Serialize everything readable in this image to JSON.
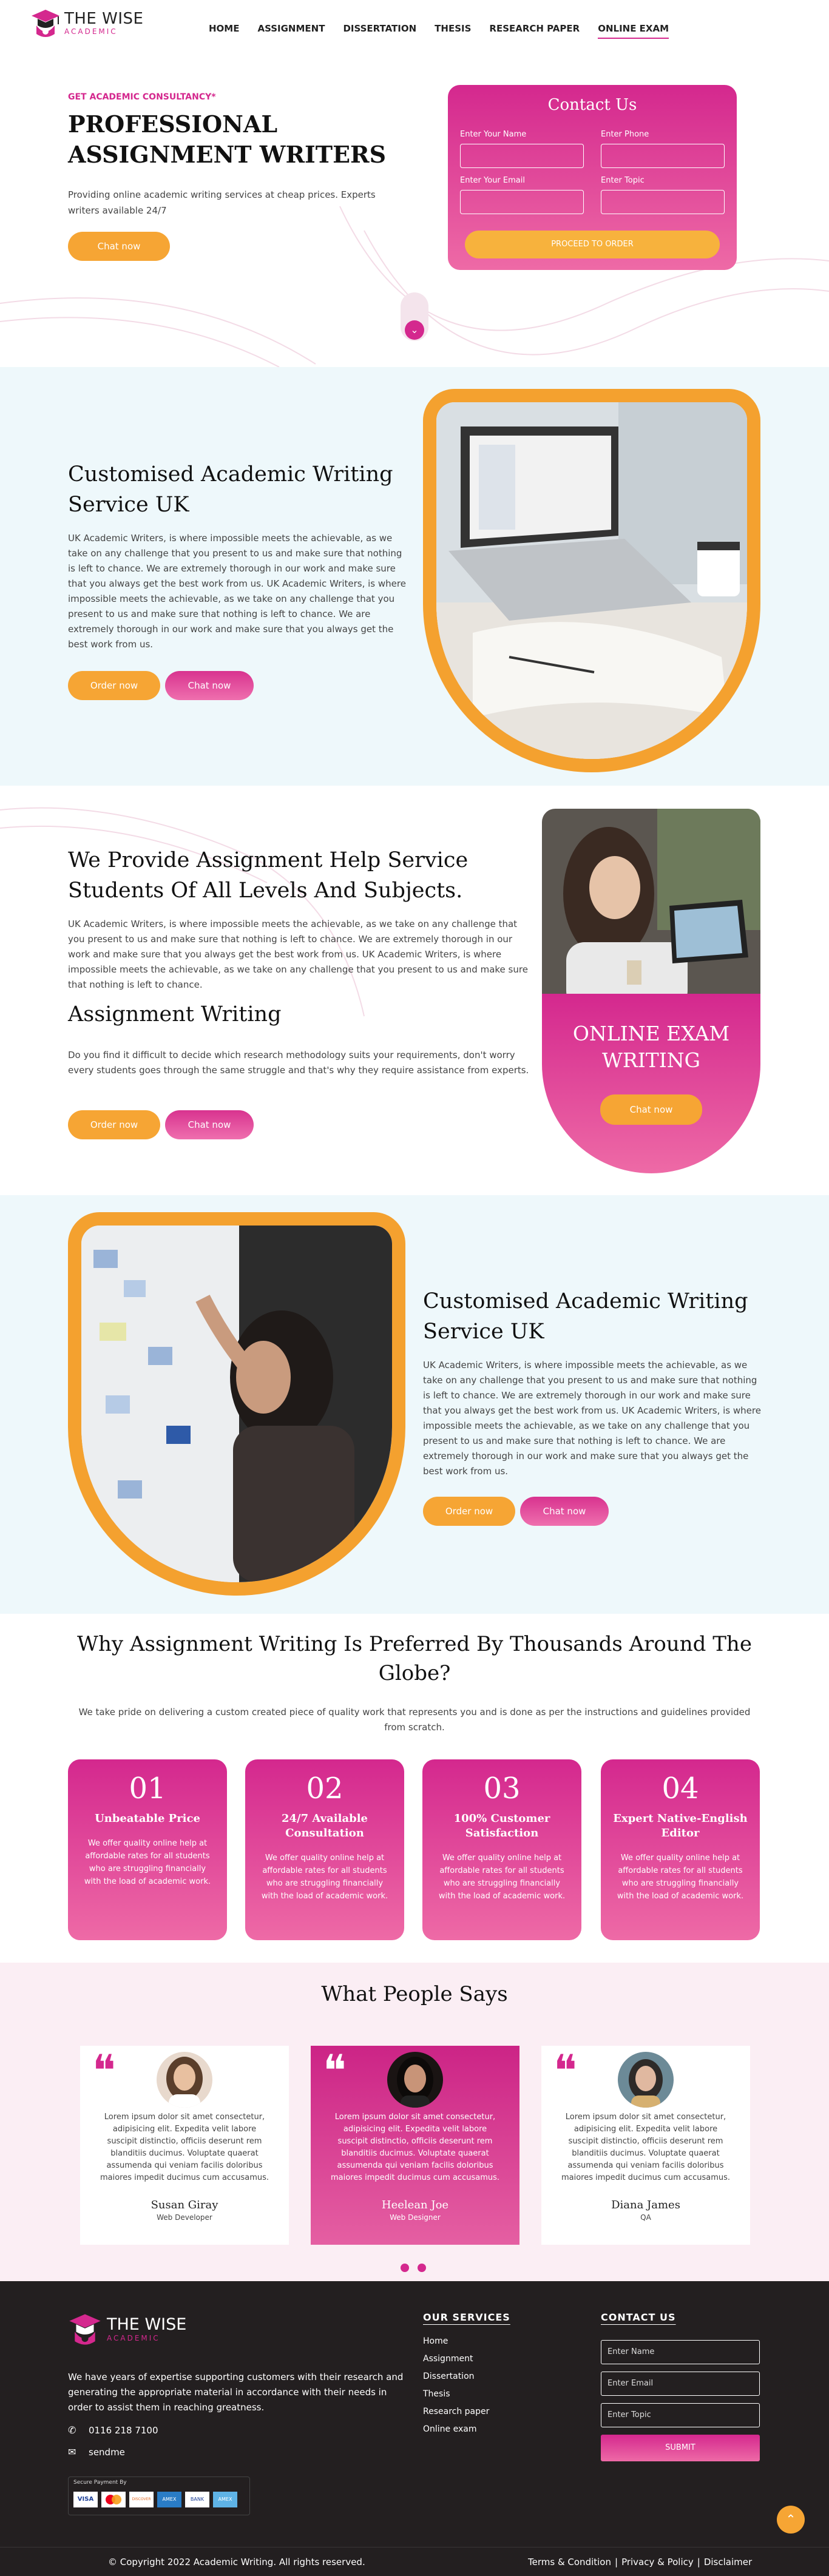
{
  "brand": {
    "name": "THE WISE",
    "sub": "ACADEMIC"
  },
  "nav": [
    "HOME",
    "ASSIGNMENT",
    "DISSERTATION",
    "THESIS",
    "RESEARCH PAPER",
    "ONLINE EXAM"
  ],
  "hero": {
    "eyebrow": "GET ACADEMIC CONSULTANCY*",
    "title_line1": "PROFESSIONAL",
    "title_line2": "ASSIGNMENT WRITERS",
    "desc": "Providing online academic writing services at cheap prices. Experts writers available 24/7",
    "chat": "Chat now"
  },
  "contact": {
    "title": "Contact Us",
    "name": "Enter Your Name",
    "phone": "Enter Phone",
    "email": "Enter Your Email",
    "topic": "Enter Topic",
    "submit": "PROCEED TO ORDER"
  },
  "section1": {
    "title_line1": "Customised Academic Writing",
    "title_line2": "Service UK",
    "body": "UK Academic Writers, is where impossible meets the achievable, as we take on any challenge that you present to us and make sure that nothing is left to chance. We are extremely thorough in our work and make sure that you always get the best work from us. UK Academic Writers, is where impossible meets the achievable, as we take on any challenge that you present to us and make sure that nothing is left to chance. We are extremely thorough in our work and make sure that you always get the best work from us.",
    "order": "Order now",
    "chat": "Chat now"
  },
  "section2": {
    "title_line1": "We Provide Assignment Help Service",
    "title_line2": "Students Of All Levels And Subjects.",
    "body": "UK Academic Writers, is where impossible meets the achievable, as we take on any challenge that you present to us and make sure that nothing is left to chance. We are extremely thorough in our work and make sure that you always get the best work from us. UK Academic Writers, is where impossible meets the achievable, as we take on any challenge that you present to us and make sure that nothing is left to chance.",
    "subtitle": "Assignment Writing",
    "body2": "Do you find it difficult to decide which research methodology suits your requirements, don't worry every students goes through the same struggle and that's why they require assistance from experts.",
    "order": "Order now",
    "chat": "Chat now",
    "card_title_line1": "ONLINE EXAM",
    "card_title_line2": "WRITING",
    "card_chat": "Chat now"
  },
  "section3": {
    "title_line1": "Customised Academic Writing",
    "title_line2": "Service UK",
    "body": "UK Academic Writers, is where impossible meets the achievable, as we take on any challenge that you present to us and make sure that nothing is left to chance. We are extremely thorough in our work and make sure that you always get the best work from us. UK Academic Writers, is where impossible meets the achievable, as we take on any challenge that you present to us and make sure that nothing is left to chance. We are extremely thorough in our work and make sure that you always get the best work from us.",
    "order": "Order now",
    "chat": "Chat now"
  },
  "why": {
    "title_line1": "Why Assignment Writing Is Preferred By Thousands Around The",
    "title_line2": "Globe?",
    "desc": "We take pride on delivering a custom created piece of quality work that represents you and is done as per the instructions and guidelines provided from scratch.",
    "cards": [
      {
        "num": "01",
        "name1": "Unbeatable Price",
        "name2": "",
        "desc": "We offer quality online help at affordable rates for all students who are struggling financially with the load of academic work."
      },
      {
        "num": "02",
        "name1": "24/7 Available",
        "name2": "Consultation",
        "desc": "We offer quality online help at affordable rates for all students who are struggling financially with the load of academic work."
      },
      {
        "num": "03",
        "name1": "100% Customer",
        "name2": "Satisfaction",
        "desc": "We offer quality online help at affordable rates for all students who are struggling financially with the load of academic work."
      },
      {
        "num": "04",
        "name1": "Expert Native-English",
        "name2": "Editor",
        "desc": "We offer quality online help at affordable rates for all students who are struggling financially with the load of academic work."
      }
    ]
  },
  "testimonials": {
    "title": "What People Says",
    "items": [
      {
        "text": "Lorem ipsum dolor sit amet consectetur, adipisicing elit. Expedita velit labore suscipit distinctio, officiis deserunt rem blanditiis ducimus. Voluptate quaerat assumenda qui veniam facilis doloribus maiores impedit ducimus cum accusamus.",
        "name": "Susan Giray",
        "role": "Web Developer"
      },
      {
        "text": "Lorem ipsum dolor sit amet consectetur, adipisicing elit. Expedita velit labore suscipit distinctio, officiis deserunt rem blanditiis ducimus. Voluptate quaerat assumenda qui veniam facilis doloribus maiores impedit ducimus cum accusamus.",
        "name": "Heelean Joe",
        "role": "Web Designer"
      },
      {
        "text": "Lorem ipsum dolor sit amet consectetur, adipisicing elit. Expedita velit labore suscipit distinctio, officiis deserunt rem blanditiis ducimus. Voluptate quaerat assumenda qui veniam facilis doloribus maiores impedit ducimus cum accusamus.",
        "name": "Diana James",
        "role": "QA"
      }
    ]
  },
  "footer": {
    "about": "We have years of expertise supporting customers with their research and generating the appropriate material in accordance with their needs in order to assist them in reaching greatness.",
    "phone": "0116 218 7100",
    "email": "sendme",
    "secure": "Secure Payment By",
    "payments": [
      "VISA",
      "MC",
      "DISCOVER",
      "AMEX",
      "BANK",
      "AMEX"
    ],
    "services_title": "OUR SERVICES",
    "services": [
      "Home",
      "Assignment",
      "Dissertation",
      "Thesis",
      "Research paper",
      "Online exam"
    ],
    "contact_title": "CONTACT US",
    "name_ph": "Enter Name",
    "email_ph": "Enter Email",
    "topic_ph": "Enter Topic",
    "submit": "SUBMIT",
    "copyright": "© Copyright 2022 Academic Writing. All rights reserved.",
    "links": [
      "Terms & Condition",
      "Privacy & Policy",
      "Disclaimer"
    ]
  },
  "colors": {
    "pink": "#d4288e",
    "orange": "#f6a534",
    "dark": "#231f20",
    "light_blue": "#eef8fb"
  }
}
